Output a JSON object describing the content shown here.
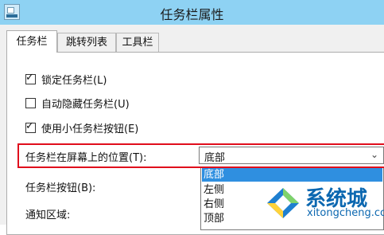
{
  "window": {
    "title": "任务栏属性"
  },
  "tabs": [
    {
      "label": "任务栏",
      "active": true
    },
    {
      "label": "跳转列表",
      "active": false
    },
    {
      "label": "工具栏",
      "active": false
    }
  ],
  "checkboxes": [
    {
      "label": "锁定任务栏(L)",
      "checked": true
    },
    {
      "label": "自动隐藏任务栏(U)",
      "checked": false
    },
    {
      "label": "使用小任务栏按钮(E)",
      "checked": true
    }
  ],
  "position_field": {
    "label": "任务栏在屏幕上的位置(T):",
    "selected": "底部",
    "options": [
      "底部",
      "左侧",
      "右侧",
      "顶部"
    ]
  },
  "buttons_field": {
    "label": "任务栏按钮(B):"
  },
  "notify_field": {
    "label": "通知区域:"
  },
  "watermark": {
    "text": "系统城",
    "url": "xitongcheng.com"
  },
  "colors": {
    "titlebar": "#8ed2f3",
    "highlight": "#e00d1c",
    "selection": "#2f8fe0",
    "watermark": "#0b67b0"
  },
  "icons": {
    "app": "taskbar-properties-icon",
    "check": "check-icon",
    "dropdown": "chevron-down-icon",
    "logo": "xitongcheng-logo-icon"
  }
}
